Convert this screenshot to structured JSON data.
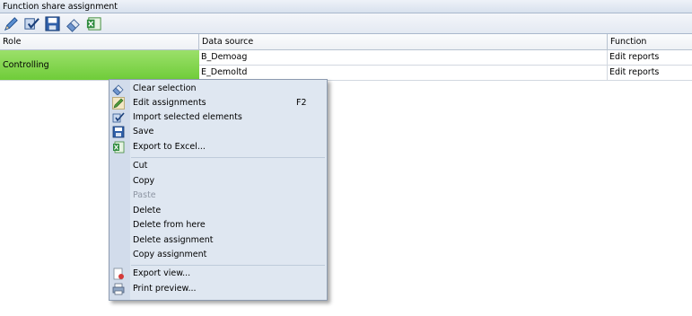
{
  "window": {
    "title": "Function share assignment"
  },
  "toolbar": {
    "buttons": [
      {
        "icon": "edit-pencil-icon"
      },
      {
        "icon": "import-check-icon"
      },
      {
        "icon": "save-floppy-icon"
      },
      {
        "icon": "eraser-icon"
      },
      {
        "icon": "excel-export-icon"
      }
    ]
  },
  "grid": {
    "columns": [
      "Role",
      "Data source",
      "Function"
    ],
    "role": "Controlling",
    "rows": [
      {
        "data_source": "B_Demoag",
        "function": "Edit reports"
      },
      {
        "data_source": "E_Demoltd",
        "function": "Edit reports"
      }
    ],
    "role_highlight_color": "#7fd449"
  },
  "context_menu": {
    "items": [
      {
        "label": "Clear selection",
        "icon": "eraser-icon"
      },
      {
        "label": "Edit assignments",
        "icon": "pencil-icon",
        "shortcut": "F2"
      },
      {
        "label": "Import selected elements",
        "icon": "import-icon"
      },
      {
        "label": "Save",
        "icon": "save-icon"
      },
      {
        "label": "Export to Excel...",
        "icon": "excel-icon"
      },
      {
        "label": "Cut"
      },
      {
        "label": "Copy"
      },
      {
        "label": "Paste",
        "disabled": true
      },
      {
        "label": "Delete"
      },
      {
        "label": "Delete from here"
      },
      {
        "label": "Delete assignment"
      },
      {
        "label": "Copy assignment"
      },
      {
        "label": "Export view...",
        "icon": "export-view-icon"
      },
      {
        "label": "Print preview...",
        "icon": "printer-icon"
      }
    ]
  }
}
